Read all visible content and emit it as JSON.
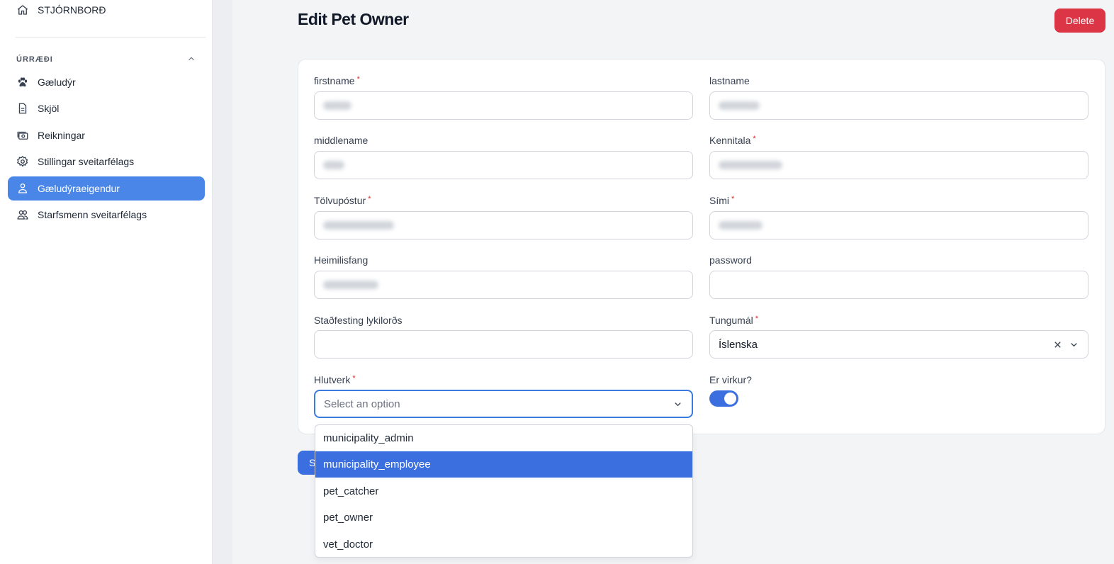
{
  "sidebar": {
    "dashboard_label": "STJÓRNBORÐ",
    "group_label": "ÚRRÆÐI",
    "items": [
      {
        "label": "Gæludýr",
        "icon": "paw-icon"
      },
      {
        "label": "Skjöl",
        "icon": "document-icon"
      },
      {
        "label": "Reikningar",
        "icon": "cash-icon"
      },
      {
        "label": "Stillingar sveitarfélags",
        "icon": "gear-icon"
      },
      {
        "label": "Gæludýraeigendur",
        "icon": "users-icon",
        "active": true
      },
      {
        "label": "Starfsmenn sveitarfélags",
        "icon": "users-icon"
      }
    ]
  },
  "header": {
    "title": "Edit Pet Owner",
    "delete_label": "Delete"
  },
  "form": {
    "firstname_label": "firstname",
    "lastname_label": "lastname",
    "middlename_label": "middlename",
    "kennitala_label": "Kennitala",
    "email_label": "Tölvupóstur",
    "phone_label": "Sími",
    "address_label": "Heimilisfang",
    "password_label": "password",
    "password_confirm_label": "Staðfesting lykilorðs",
    "language_label": "Tungumál",
    "language_value": "Íslenska",
    "role_label": "Hlutverk",
    "role_placeholder": "Select an option",
    "active_label": "Er virkur?",
    "active_value": true,
    "save_label": "S",
    "required_mark": "*"
  },
  "role_options": [
    "municipality_admin",
    "municipality_employee",
    "pet_catcher",
    "pet_owner",
    "vet_doctor"
  ],
  "role_highlighted": "municipality_employee",
  "colors": {
    "primary": "#3b6fe0",
    "sidebar_active": "#4a86e8",
    "danger": "#dc3545"
  }
}
